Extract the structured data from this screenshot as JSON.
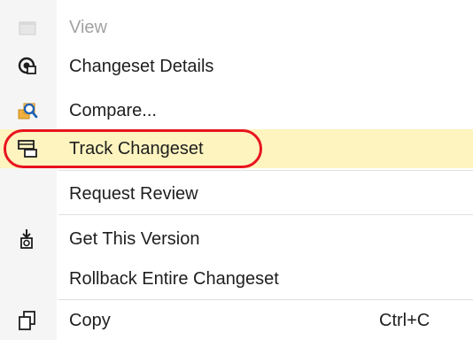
{
  "menu": {
    "items": [
      {
        "label": "View",
        "icon": "view-icon",
        "disabled": true
      },
      {
        "label": "Changeset Details",
        "icon": "changeset-details-icon"
      },
      {
        "label": "Compare...",
        "icon": "compare-icon"
      },
      {
        "label": "Track Changeset",
        "icon": "track-changeset-icon",
        "highlighted": true
      },
      {
        "label": "Request Review",
        "icon": ""
      },
      {
        "label": "Get This Version",
        "icon": "get-version-icon"
      },
      {
        "label": "Rollback Entire Changeset",
        "icon": ""
      },
      {
        "label": "Copy",
        "icon": "copy-icon",
        "shortcut": "Ctrl+C"
      }
    ]
  },
  "colors": {
    "highlight": "#fdf4bf",
    "callout": "#e8141e",
    "disabled_text": "#a2a2a2",
    "gutter": "#f5f5f5"
  }
}
